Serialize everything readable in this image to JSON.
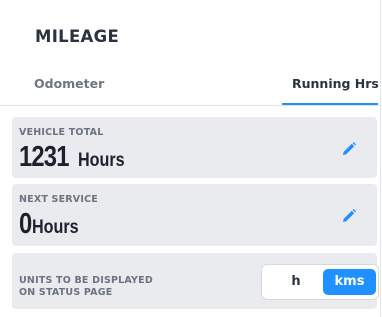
{
  "panel": {
    "title": "MILEAGE"
  },
  "tabs": [
    {
      "label": "Odometer",
      "active": false
    },
    {
      "label": "Running Hrs",
      "active": true
    }
  ],
  "vehicle_total": {
    "label": "VEHICLE TOTAL",
    "value": "1231",
    "unit": "Hours"
  },
  "next_service": {
    "label": "NEXT SERVICE",
    "value": "0",
    "unit": "Hours"
  },
  "units": {
    "label_line1": "UNITS TO BE DISPLAYED",
    "label_line2": "ON STATUS PAGE",
    "options": [
      "h",
      "kms"
    ],
    "selected": "kms"
  },
  "colors": {
    "accent": "#1e90ff",
    "card_bg": "#e9ebef",
    "text": "#1c222c"
  },
  "icons": {
    "edit": "pencil-icon"
  }
}
